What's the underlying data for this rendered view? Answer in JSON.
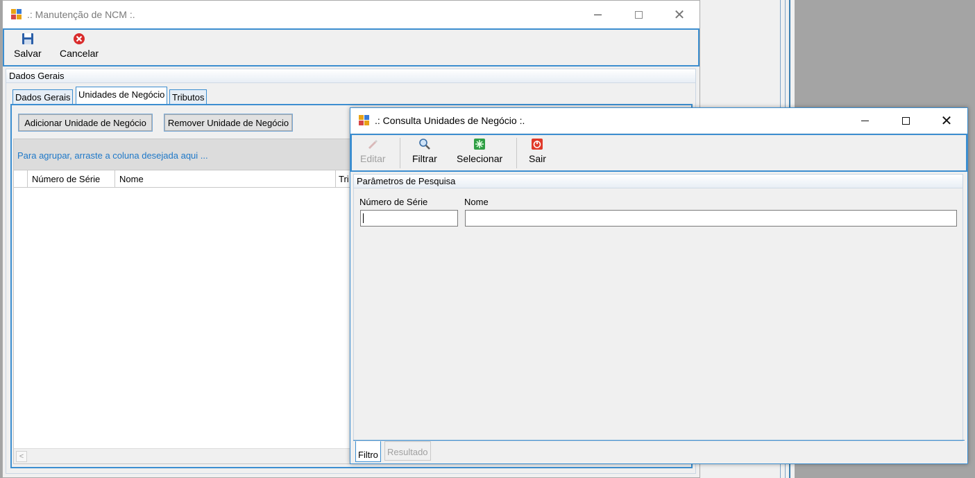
{
  "main_window": {
    "title": ".: Manutenção de NCM :.",
    "toolbar": {
      "save_label": "Salvar",
      "cancel_label": "Cancelar"
    },
    "group_title": "Dados Gerais",
    "tabs": [
      "Dados Gerais",
      "Unidades de Negócio",
      "Tributos"
    ],
    "add_button_label": "Adicionar Unidade de Negócio",
    "remove_button_label": "Remover Unidade de Negócio",
    "group_panel_hint": "Para agrupar, arraste a coluna desejada aqui ...",
    "grid_columns": [
      "Número de Série",
      "Nome",
      "Tri"
    ]
  },
  "dialog": {
    "title": ".: Consulta Unidades de Negócio :.",
    "toolbar": {
      "edit_label": "Editar",
      "filter_label": "Filtrar",
      "select_label": "Selecionar",
      "exit_label": "Sair"
    },
    "group_title": "Parâmetros de Pesquisa",
    "serial_label": "Número de Série",
    "name_label": "Nome",
    "serial_value": "",
    "name_value": "",
    "tabs": [
      "Filtro",
      "Resultado"
    ]
  },
  "colors": {
    "accent": "#3c8ed0",
    "hint_text": "#1e78c8",
    "desktop": "#a4a4a4"
  },
  "icons": [
    "app-icon",
    "save-icon",
    "cancel-icon",
    "edit-icon",
    "filter-icon",
    "select-icon",
    "exit-icon",
    "minimize-icon",
    "maximize-icon",
    "close-icon"
  ]
}
